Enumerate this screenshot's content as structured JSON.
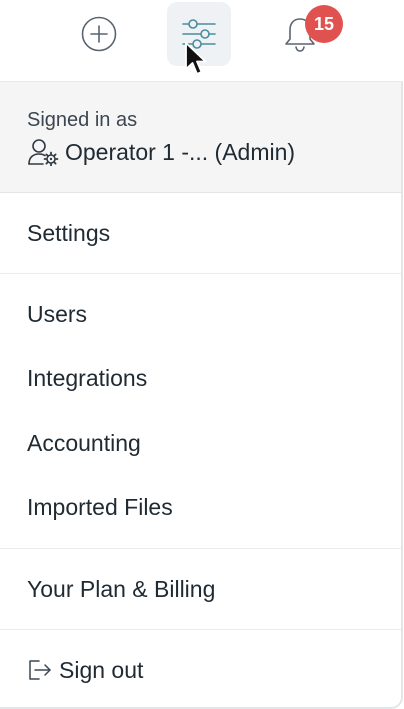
{
  "topbar": {
    "icons": [
      "plus-circle-icon",
      "sliders-icon",
      "bell-icon"
    ],
    "notification_count": "15",
    "badge_color": "#e0524f"
  },
  "account": {
    "signed_in_label": "Signed in as",
    "user_icon": "user-gear-icon",
    "user_name": "Operator 1 -... (Admin)"
  },
  "menu": {
    "settings": "Settings",
    "admin_items": [
      "Users",
      "Integrations",
      "Accounting",
      "Imported Files"
    ],
    "billing": "Your Plan & Billing",
    "sign_out": "Sign out",
    "sign_out_icon": "sign-out-icon"
  },
  "colors": {
    "accent": "#4a8c9c",
    "panel_header_bg": "#f5f5f5",
    "text": "#1f2a33"
  }
}
